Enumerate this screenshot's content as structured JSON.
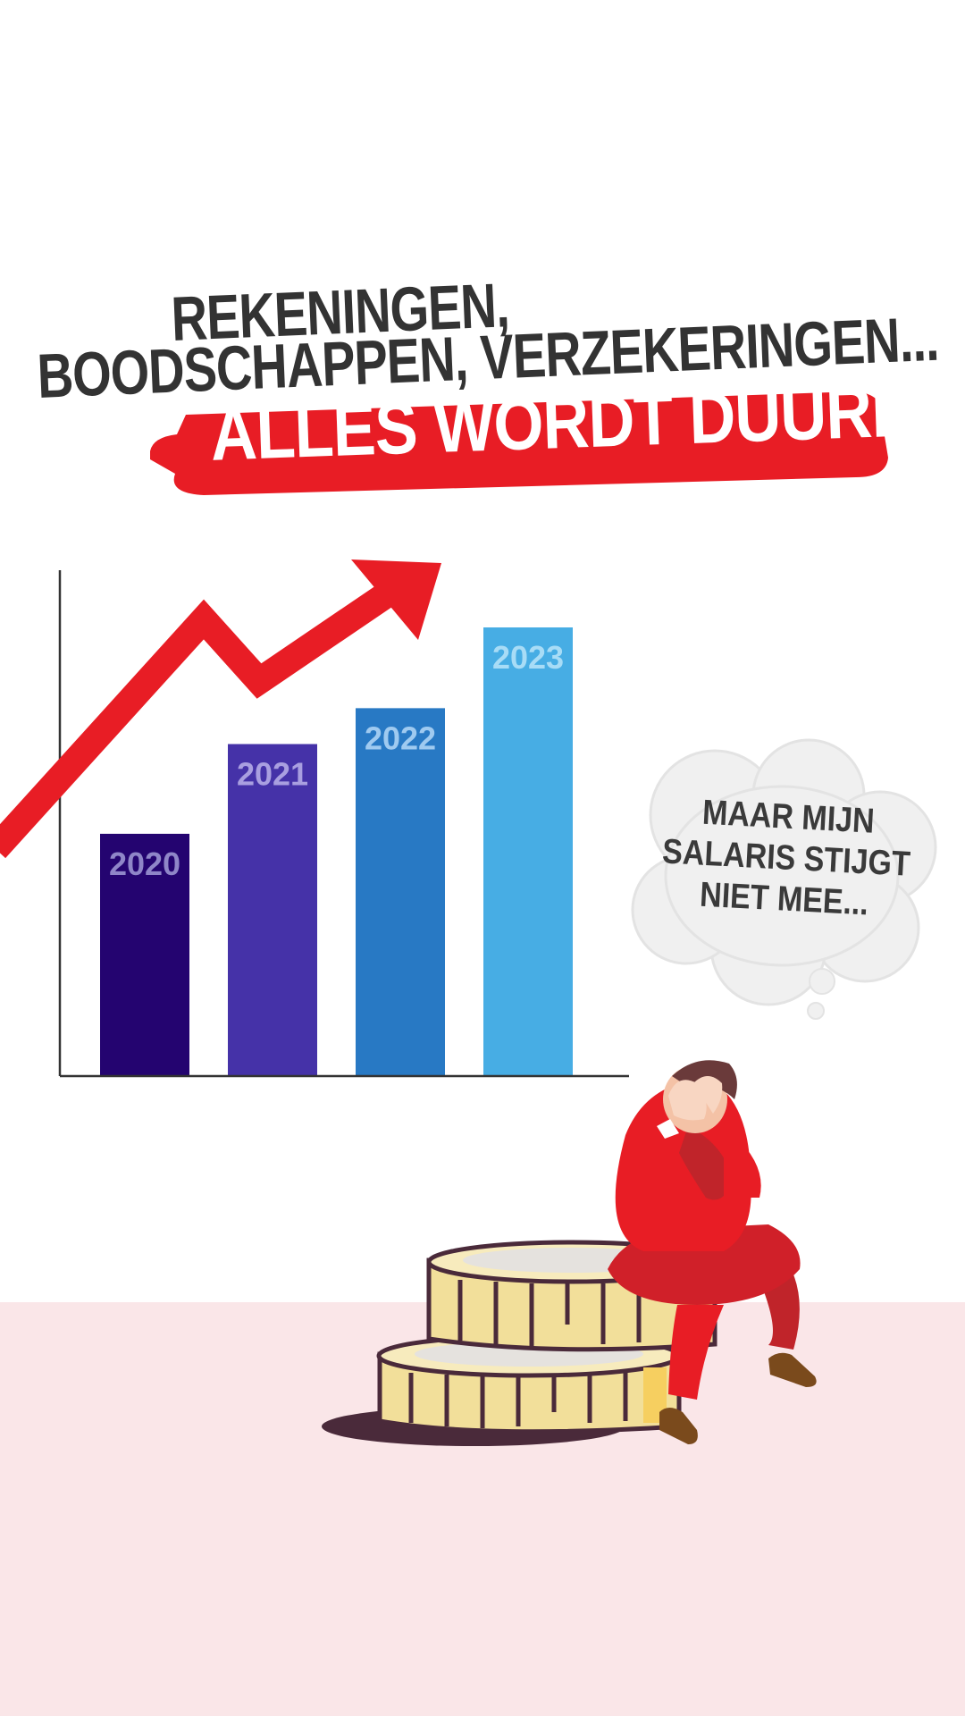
{
  "headline": {
    "line1": "REKENINGEN,",
    "line2": "BOODSCHAPPEN, VERZEKERINGEN...",
    "banner": "ALLES WORDT DUURDER"
  },
  "thought_bubble": {
    "lines": [
      "MAAR MIJN",
      "SALARIS STIJGT",
      "NIET MEE..."
    ]
  },
  "colors": {
    "accent_red": "#e81d25",
    "text_dark": "#333333",
    "floor_pink": "#fae6e8",
    "coin_gold": "#f2df9a",
    "coin_outline": "#4a2a3a"
  },
  "icons": [
    "trend-arrow-icon",
    "thought-cloud-icon",
    "coin-stack-icon",
    "stressed-man-icon"
  ],
  "chart_data": {
    "type": "bar",
    "categories": [
      "2020",
      "2021",
      "2022",
      "2023"
    ],
    "values": [
      54,
      74,
      82,
      100
    ],
    "ylim": [
      0,
      100
    ],
    "bar_colors": [
      "#240470",
      "#4532a8",
      "#2879c4",
      "#47ade4"
    ],
    "label_colors": [
      "#8f86c8",
      "#a99fe0",
      "#9fcaf0",
      "#a8dcf6"
    ],
    "grid": false,
    "trend_arrow": true
  }
}
